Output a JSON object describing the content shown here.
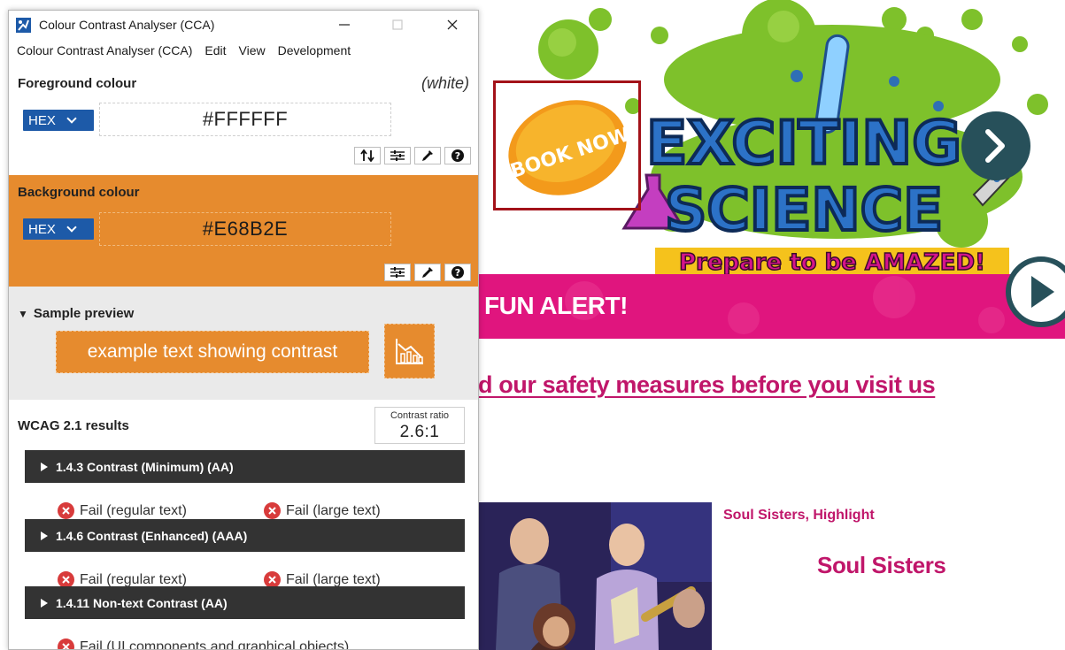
{
  "window": {
    "title": "Colour Contrast Analyser (CCA)",
    "menu": [
      "Colour Contrast Analyser (CCA)",
      "Edit",
      "View",
      "Development"
    ]
  },
  "foreground": {
    "label": "Foreground colour",
    "name": "(white)",
    "format": "HEX",
    "hex": "#FFFFFF",
    "icons": [
      "swap-icon",
      "sliders-icon",
      "eyedropper-icon",
      "help-icon"
    ]
  },
  "background": {
    "label": "Background colour",
    "format": "HEX",
    "hex": "#E68B2E",
    "color": "#E68B2E",
    "icons": [
      "sliders-icon",
      "eyedropper-icon",
      "help-icon"
    ]
  },
  "sample": {
    "label": "Sample preview",
    "text": "example text showing contrast",
    "icon": "chart-icon"
  },
  "results": {
    "label": "WCAG 2.1 results",
    "ratio_caption": "Contrast ratio",
    "ratio_value": "2.6:1",
    "criteria": [
      {
        "title": "1.4.3 Contrast (Minimum) (AA)",
        "regular": "Fail (regular text)",
        "large": "Fail (large text)"
      },
      {
        "title": "1.4.6 Contrast (Enhanced) (AAA)",
        "regular": "Fail (regular text)",
        "large": "Fail (large text)"
      },
      {
        "title": "1.4.11 Non-text Contrast (AA)",
        "ui": "Fail (UI components and graphical objects)"
      }
    ]
  },
  "webpage": {
    "hero_badge": "BOOK NOW!",
    "hero_title_1": "EXCITING",
    "hero_title_2": "SCIENCE",
    "hero_tagline": "Prepare to be AMAZED!",
    "banner_text": "FUN ALERT!",
    "safety_link": "d our safety measures before you visit us",
    "show_caption": "Soul Sisters, Highlight",
    "show_title": "Soul Sisters"
  },
  "colors": {
    "accent_orange": "#E68B2E",
    "brand_pink": "#E0157E",
    "link_pink": "#C0166A",
    "fail_red": "#D83B3B",
    "select_blue": "#1D5AA8"
  }
}
